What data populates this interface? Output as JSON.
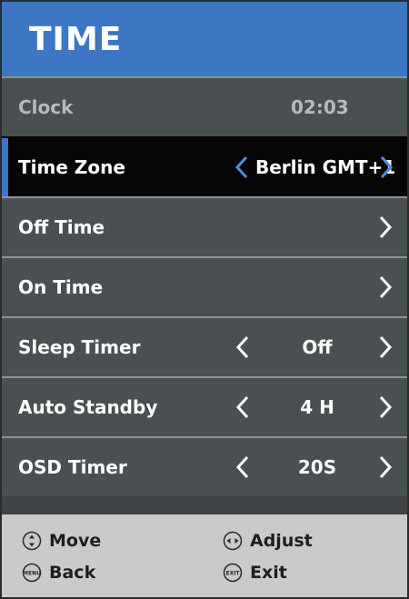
{
  "header": {
    "title": "TIME"
  },
  "menu": {
    "clock": {
      "label": "Clock",
      "value": "02:03"
    },
    "time_zone": {
      "label": "Time Zone",
      "value": "Berlin GMT+1"
    },
    "off_time": {
      "label": "Off Time"
    },
    "on_time": {
      "label": "On Time"
    },
    "sleep_timer": {
      "label": "Sleep Timer",
      "value": "Off"
    },
    "auto_standby": {
      "label": "Auto Standby",
      "value": "4 H"
    },
    "osd_timer": {
      "label": "OSD Timer",
      "value": "20S"
    }
  },
  "footer": {
    "move": "Move",
    "adjust": "Adjust",
    "back": "Back",
    "exit": "Exit",
    "menu_icon_text": "MENU",
    "exit_icon_text": "EXIT"
  },
  "colors": {
    "header_bg": "#3d76c3",
    "row_bg": "#4a5052",
    "selected_bg": "#060606",
    "accent_arrow": "#4f8fe0",
    "footer_bg": "#c9cbcb"
  }
}
